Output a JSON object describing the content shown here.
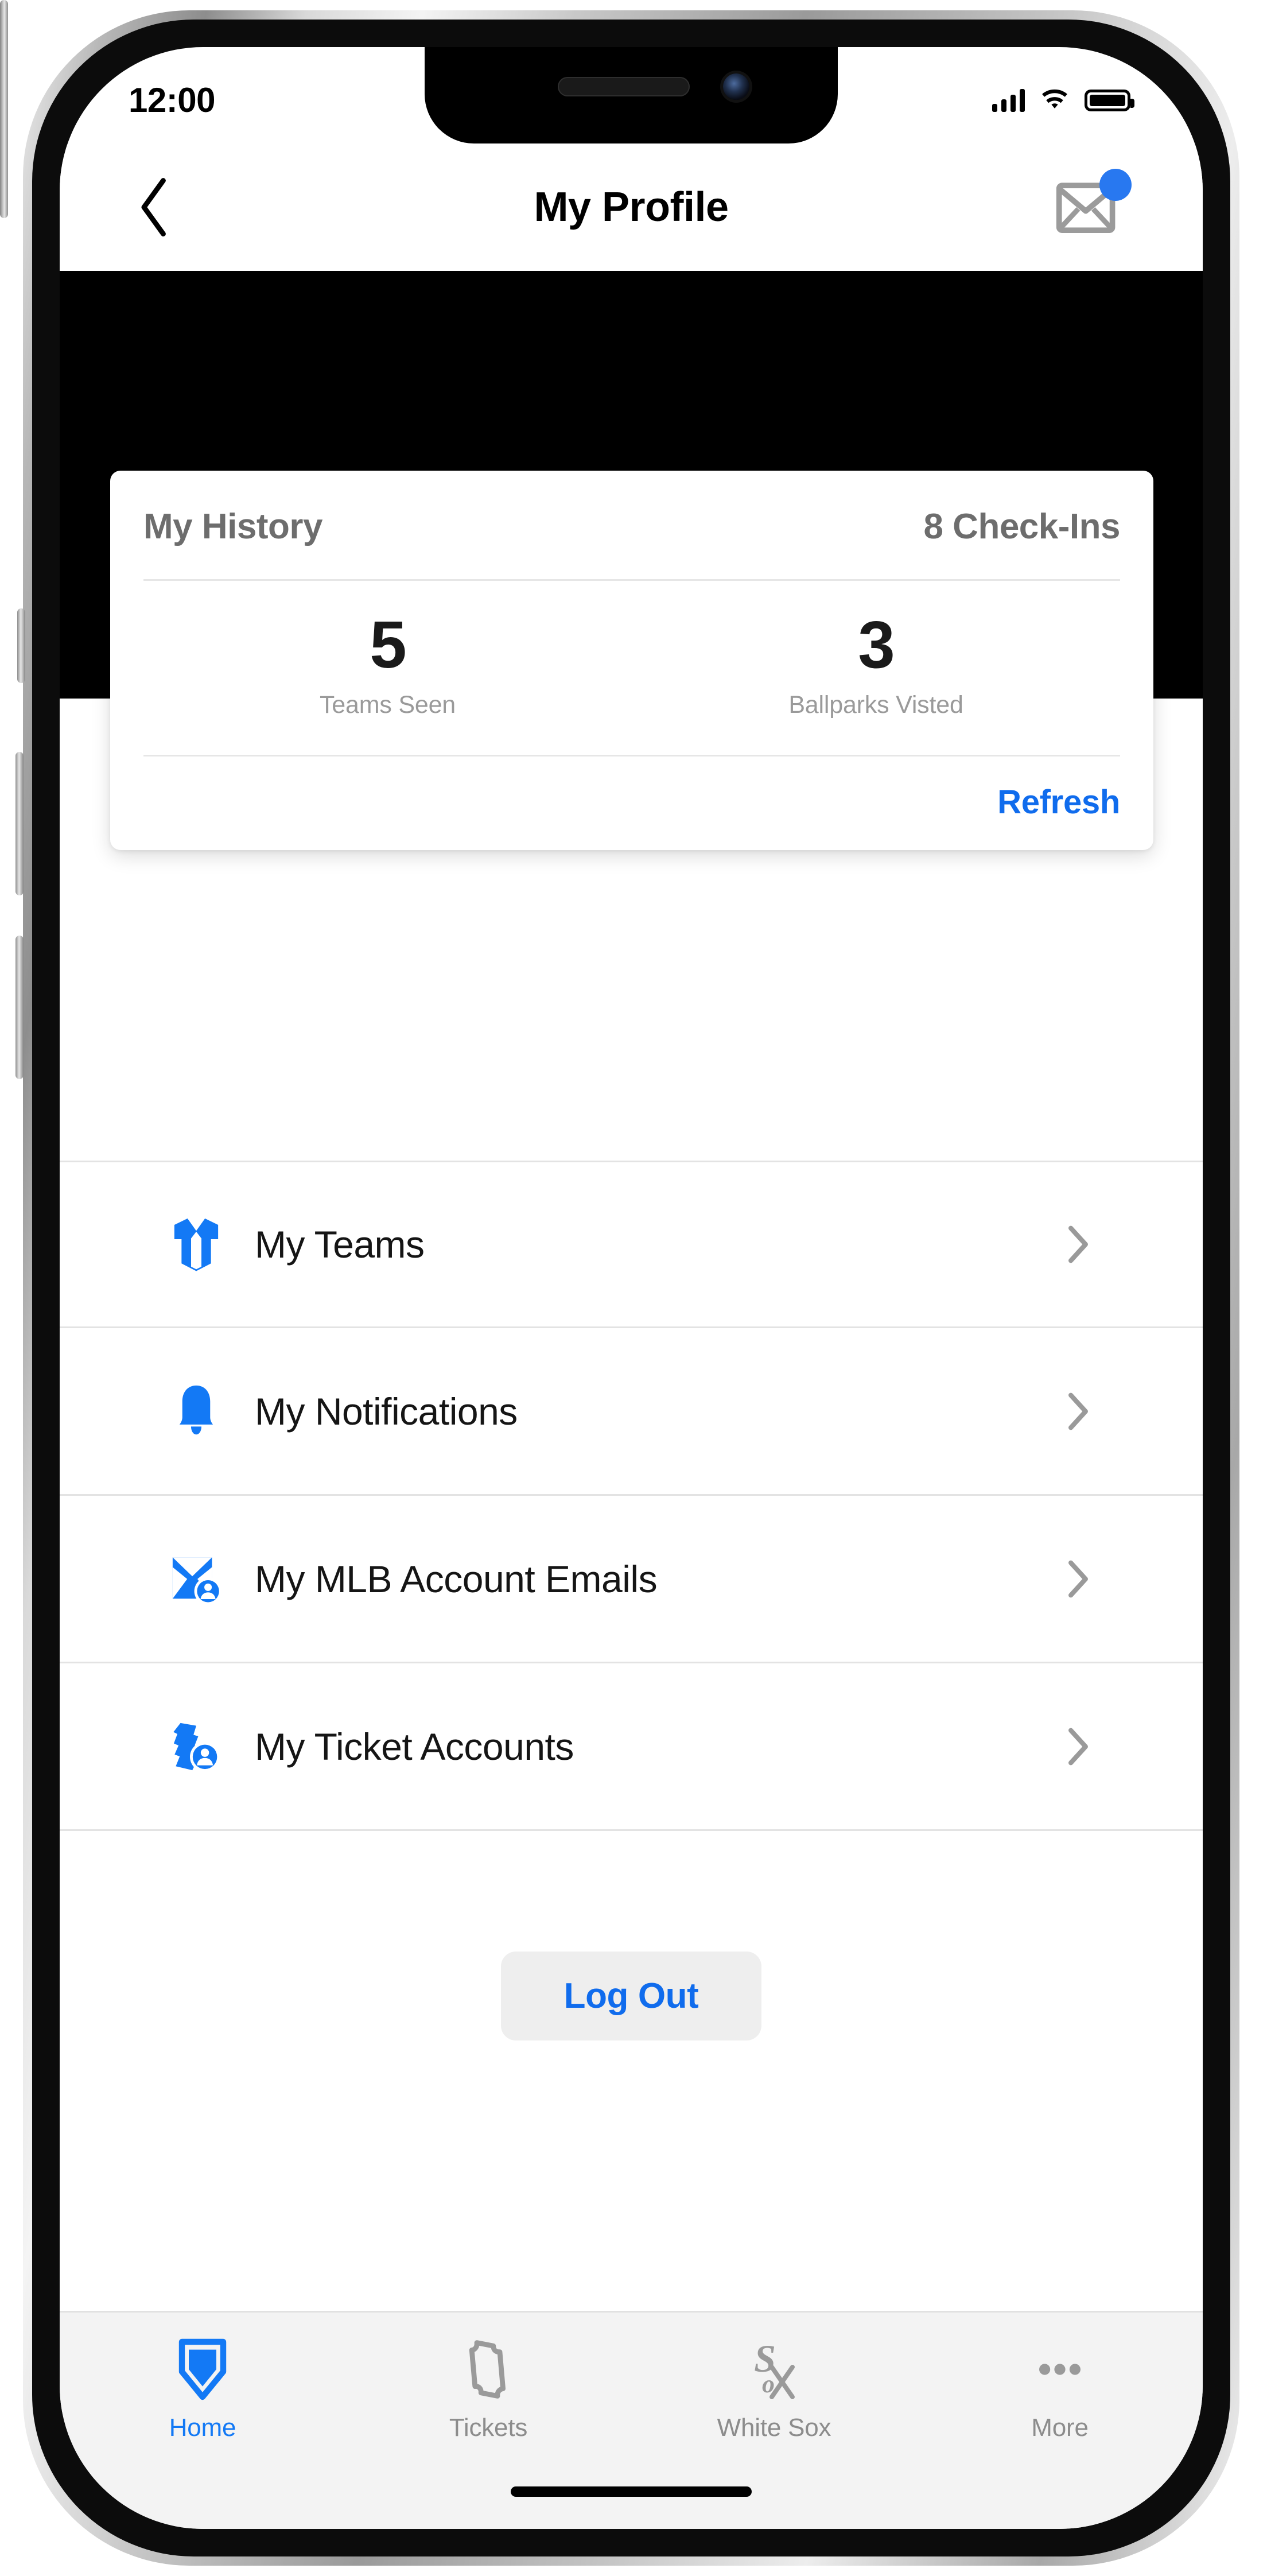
{
  "status_bar": {
    "time": "12:00",
    "signal_icon": "cellular-signal-icon",
    "wifi_icon": "wifi-icon",
    "battery_icon": "battery-full-icon"
  },
  "header": {
    "back_icon": "chevron-left-icon",
    "title": "My Profile",
    "mail_icon": "envelope-icon",
    "mail_badge": "unread-dot",
    "badge_color": "#2878f0"
  },
  "history_card": {
    "title": "My History",
    "checkins": "8 Check-Ins",
    "stats": [
      {
        "value": "5",
        "label": "Teams Seen"
      },
      {
        "value": "3",
        "label": "Ballparks Visted"
      }
    ],
    "refresh_label": "Refresh",
    "refresh_color": "#106ced"
  },
  "menu": {
    "items": [
      {
        "label": "My Teams",
        "icon": "jersey-icon",
        "chevron": "chevron-right-icon"
      },
      {
        "label": "My Notifications",
        "icon": "bell-icon",
        "chevron": "chevron-right-icon"
      },
      {
        "label": "My MLB Account Emails",
        "icon": "envelope-account-icon",
        "chevron": "chevron-right-icon"
      },
      {
        "label": "My Ticket Accounts",
        "icon": "ticket-account-icon",
        "chevron": "chevron-right-icon"
      }
    ]
  },
  "logout": {
    "label": "Log Out"
  },
  "tab_bar": {
    "items": [
      {
        "label": "Home",
        "icon": "home-plate-icon",
        "active": true
      },
      {
        "label": "Tickets",
        "icon": "ticket-icon",
        "active": false
      },
      {
        "label": "White Sox",
        "icon": "white-sox-logo",
        "active": false
      },
      {
        "label": "More",
        "icon": "ellipsis-icon",
        "active": false
      }
    ],
    "active_color": "#1379f5",
    "inactive_color": "#8c8c8c"
  },
  "theme": {
    "accent_blue": "#1379f5",
    "hero_band": "#000000",
    "tabbar_bg": "#f3f3f3"
  }
}
